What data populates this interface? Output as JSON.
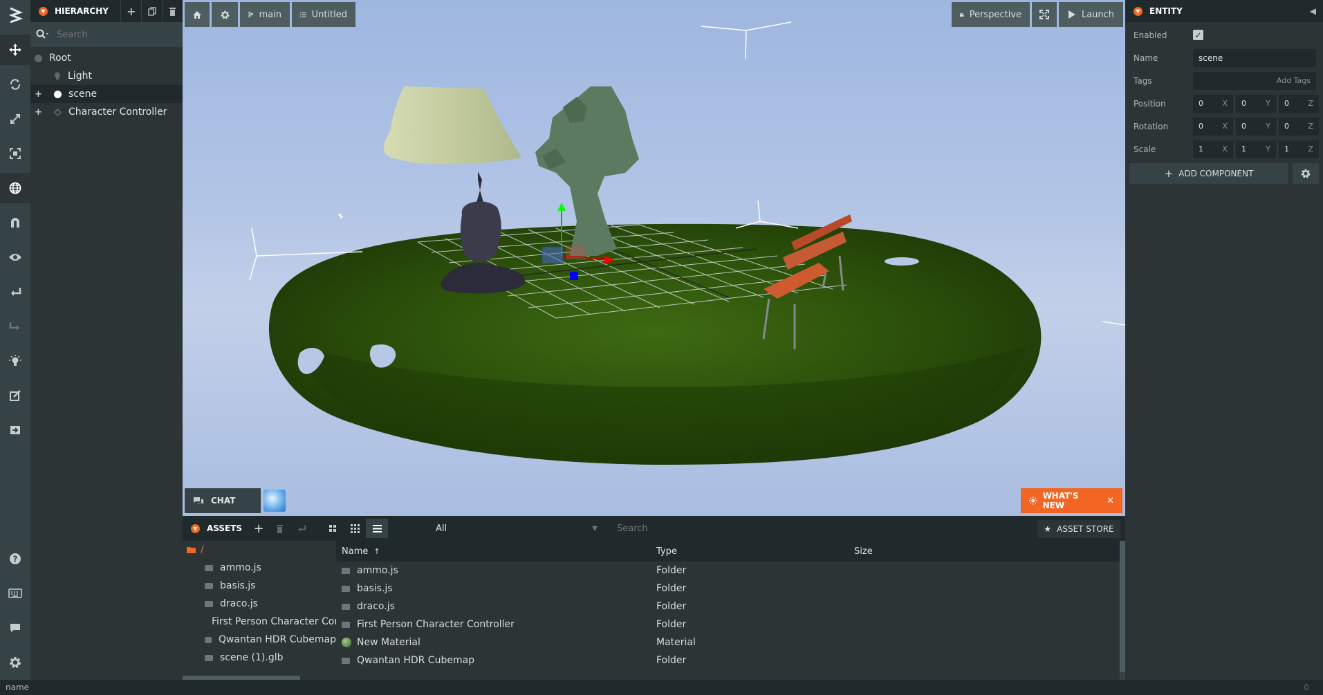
{
  "hierarchy": {
    "title": "HIERARCHY",
    "search_placeholder": "Search",
    "items": [
      {
        "label": "Root"
      },
      {
        "label": "Light"
      },
      {
        "label": "scene"
      },
      {
        "label": "Character Controller"
      }
    ]
  },
  "viewport": {
    "branch_label": "main",
    "scene_label": "Untitled",
    "camera_label": "Perspective",
    "launch_label": "Launch",
    "chat_label": "CHAT",
    "whats_new_label": "WHAT'S NEW"
  },
  "entity": {
    "title": "ENTITY",
    "enabled_label": "Enabled",
    "name_label": "Name",
    "name_value": "scene",
    "tags_label": "Tags",
    "add_tags_label": "Add Tags",
    "position_label": "Position",
    "rotation_label": "Rotation",
    "scale_label": "Scale",
    "position": [
      "0",
      "0",
      "0"
    ],
    "rotation": [
      "0",
      "0",
      "0"
    ],
    "scale": [
      "1",
      "1",
      "1"
    ],
    "axes": [
      "X",
      "Y",
      "Z"
    ],
    "add_component_label": "ADD COMPONENT"
  },
  "assets": {
    "title": "ASSETS",
    "filter_value": "All",
    "search_placeholder": "Search",
    "store_label": "ASSET STORE",
    "root_label": "/",
    "tree": [
      "ammo.js",
      "basis.js",
      "draco.js",
      "First Person Character Controller",
      "Qwantan HDR Cubemap",
      "scene (1).glb"
    ],
    "columns": {
      "name": "Name",
      "type": "Type",
      "size": "Size"
    },
    "rows": [
      {
        "name": "ammo.js",
        "type": "Folder"
      },
      {
        "name": "basis.js",
        "type": "Folder"
      },
      {
        "name": "draco.js",
        "type": "Folder"
      },
      {
        "name": "First Person Character Controller",
        "type": "Folder"
      },
      {
        "name": "New Material",
        "type": "Material"
      },
      {
        "name": "Qwantan HDR Cubemap",
        "type": "Folder"
      }
    ]
  },
  "status": {
    "text": "name",
    "count": "0"
  },
  "colors": {
    "accent": "#f26522",
    "panel": "#2c3436",
    "panel_dark": "#20292b",
    "toolbar": "#364346"
  }
}
